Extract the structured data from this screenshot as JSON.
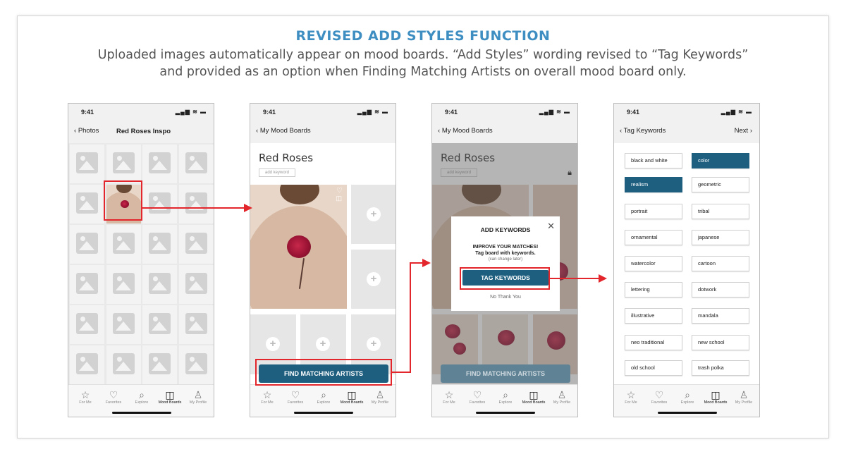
{
  "header": {
    "title": "REVISED ADD STYLES FUNCTION",
    "subtitle_line1": "Uploaded images automatically appear on mood boards. “Add Styles” wording revised to “Tag Keywords”",
    "subtitle_line2": "and provided as an option when Finding Matching Artists on overall mood board only."
  },
  "status": {
    "time": "9:41",
    "signal": "▂▄▆ ≋ ▬"
  },
  "tabbar": {
    "items": [
      {
        "label": "For Me",
        "icon": "☆"
      },
      {
        "label": "Favorites",
        "icon": "♡"
      },
      {
        "label": "Explore",
        "icon": "⌕"
      },
      {
        "label": "Mood Boards",
        "icon": "◫"
      },
      {
        "label": "My Profile",
        "icon": "♙"
      }
    ]
  },
  "screen1": {
    "back": "Photos",
    "title": "Red Roses Inspo"
  },
  "screen2": {
    "back": "My Mood Boards",
    "board_title": "Red Roses",
    "add_keyword": "add keyword",
    "find_button": "FIND MATCHING ARTISTS"
  },
  "screen3": {
    "back": "My Mood Boards",
    "board_title": "Red Roses",
    "add_keyword": "add keyword",
    "modal": {
      "title": "ADD KEYWORDS",
      "line1": "IMPROVE YOUR MATCHES!",
      "line2": "Tag board with keywords.",
      "line3": "(can change later)",
      "tag_button": "TAG KEYWORDS",
      "no_thanks": "No Thank You"
    },
    "find_button": "FIND MATCHING ARTISTS"
  },
  "screen4": {
    "back": "Tag Keywords",
    "next": "Next",
    "keywords": [
      {
        "label": "black and white",
        "selected": false
      },
      {
        "label": "color",
        "selected": true
      },
      {
        "label": "realism",
        "selected": true
      },
      {
        "label": "geometric",
        "selected": false
      },
      {
        "label": "portrait",
        "selected": false
      },
      {
        "label": "tribal",
        "selected": false
      },
      {
        "label": "ornamental",
        "selected": false
      },
      {
        "label": "japanese",
        "selected": false
      },
      {
        "label": "watercolor",
        "selected": false
      },
      {
        "label": "cartoon",
        "selected": false
      },
      {
        "label": "lettering",
        "selected": false
      },
      {
        "label": "dotwork",
        "selected": false
      },
      {
        "label": "illustrative",
        "selected": false
      },
      {
        "label": "mandala",
        "selected": false
      },
      {
        "label": "neo traditional",
        "selected": false
      },
      {
        "label": "new school",
        "selected": false
      },
      {
        "label": "old school",
        "selected": false
      },
      {
        "label": "trash polka",
        "selected": false
      }
    ]
  },
  "colors": {
    "accent": "#1e5f80",
    "heading": "#3f8ec2",
    "highlight": "#e3252c"
  }
}
